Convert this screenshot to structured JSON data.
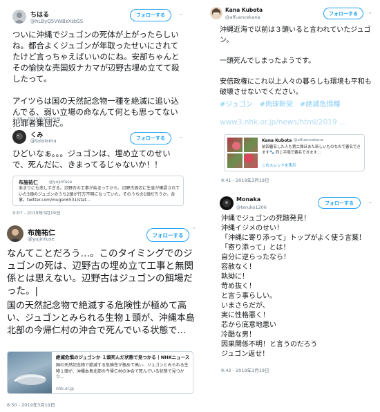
{
  "tweet1": {
    "name": "ちはる",
    "handle": "@hLByQ5VWBzXsbSS",
    "follow_label": "フォローする",
    "text": "ついに沖縄でジュゴンの死体が上がったらしいね。都合よくジュゴンが年取ったせいにされてたけど言っちゃえばいいのにね。安部ちゃんとその愉快な売国奴ナカマが辺野古埋め立てて殺したって。\n\nアイツらは国の天然記念物一種を絶滅に追い込んでる、弱い立場の命なんて何とも思ってない犯罪者集団だ。",
    "timestamp": "7:39 - 2019年3月19日"
  },
  "tweet2": {
    "name": "くみ",
    "handle": "@talalama",
    "follow_label": "フォローする",
    "text": "ひどいなぁ。。。ジュゴンは、埋め立てのせいで、死んだに、きまってるじゃないか！！",
    "quote": {
      "name": "布施祐仁",
      "handle": "@yujinfuse",
      "text": "あまりにも悲しすぎる。辺野古の工事が始まってから、辺野古周辺に生息が確認されていた3頭のジュゴンのうち2頭が行方不明になっていた。そのうちの1頭だろうか。合掌。twitter.com/mugen6531/stat…"
    },
    "timestamp": "9:07 - 2019年3月19日"
  },
  "tweet3": {
    "name": "布施祐仁",
    "handle": "@yujinfuse",
    "follow_label": "フォローする",
    "text_main": "なんてことだろう…。このタイミングでのジュゴンの死は、辺野古の埋め立て工事と無関係とは思えない。辺野古はジュゴンの餌場だった。|",
    "text_sub": "国の天然記念物で絶滅する危険性が極めて高い、ジュゴンとみられる生物１頭が、沖縄本島北部の今帰仁村の沖合で死んでいる状態で…",
    "card": {
      "title": "絶滅危惧のジュゴンか １頭死んだ状態で見つかる | NHKニュース",
      "desc": "国の天然記念物で絶滅する危険性が極めて高い、ジュゴンとみられる生物１頭が、沖縄本島北部の今帰仁村の沖合で死んでいる状態で見つかり…",
      "domain": "nhk.or.jp"
    },
    "timestamp": "8:50 - 2019年3月19日"
  },
  "tweet4": {
    "name": "Kana Kubota",
    "handle": "@affuencekana",
    "follow_label": "フォローする",
    "text": "沖縄近海で以前は３頭いると言われていたジュゴン。\n\n一頭死んでしまったようです。\n\n安倍政権にこれ以上人々の暮らしも環境も平和も破壊させないでください。",
    "hashtags": "#ジュゴン　#肉球新党　#絶滅危惧種",
    "link": "www3.nhk.or.jp/news/html/2019 …",
    "quote": {
      "name": "Kana Kubota",
      "handle": "@affuencekana",
      "text": "前回審名した人も第二弾ほまた新しいものなので審名できます🐾 同じ手順で審名できます...",
      "thread": "このスレッドを表示"
    },
    "timestamp": "9:41 - 2019年3月19日"
  },
  "tweet5": {
    "name": "Monaka",
    "handle": "@teruko1206",
    "follow_label": "フォローする",
    "text": "沖縄でジュゴンの死骸発見！\n沖縄イジメのせい！\n「沖縄に寄り添って」トップがよく使う言葉！\n「寄り添って」とは！\n自分に逆らったなら！\n容赦なく！\n執拗に！\n苛め抜く！\nと言う事らしい。\nいまさらだが、\n実に性格悪く！\n芯から底意地悪い\n冷酷な男！\n因果関係不明！と言うのだろう\nジュゴン返せ！",
    "timestamp": "9:42 - 2019年3月19日"
  }
}
